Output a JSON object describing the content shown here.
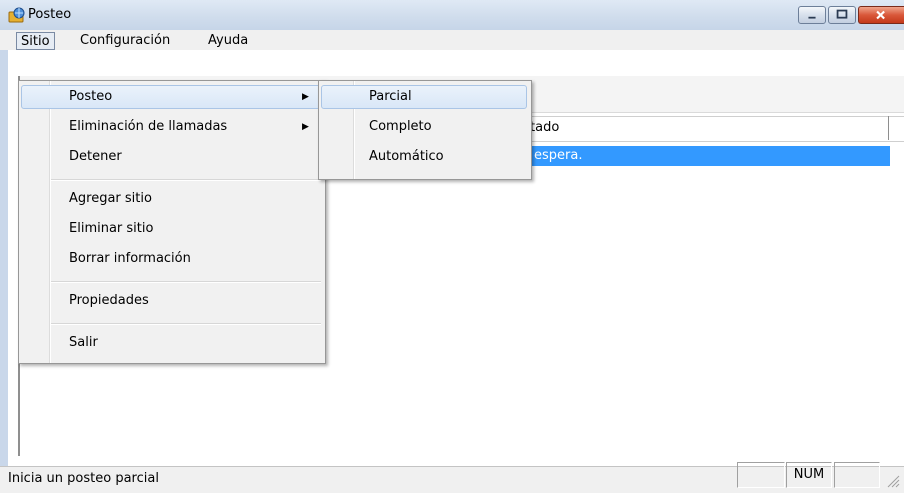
{
  "window": {
    "title": "Posteo",
    "app_icon": "folder-globe-icon"
  },
  "caption_buttons": [
    "minimize-icon",
    "maximize-icon",
    "close-icon"
  ],
  "menubar": {
    "items": [
      "Sitio",
      "Configuración",
      "Ayuda"
    ]
  },
  "sitio_menu": {
    "items": [
      {
        "label": "Posteo",
        "submenu": true
      },
      {
        "label": "Eliminación de llamadas",
        "submenu": true
      },
      {
        "label": "Detener"
      },
      {
        "label": "Agregar sitio"
      },
      {
        "label": "Eliminar sitio"
      },
      {
        "label": "Borrar información"
      },
      {
        "label": "Propiedades"
      },
      {
        "label": "Salir"
      }
    ]
  },
  "posteo_submenu": {
    "items": [
      "Parcial",
      "Completo",
      "Automático"
    ]
  },
  "list": {
    "column_partial": "tado",
    "selected_row_partial": "espera."
  },
  "statusbar": {
    "text": "Inicia un posteo parcial",
    "num_indicator": "NUM"
  },
  "colors": {
    "selection": "#3399ff",
    "menu_highlight": "#d9e7f7",
    "titlebar": "#cfdcec"
  }
}
